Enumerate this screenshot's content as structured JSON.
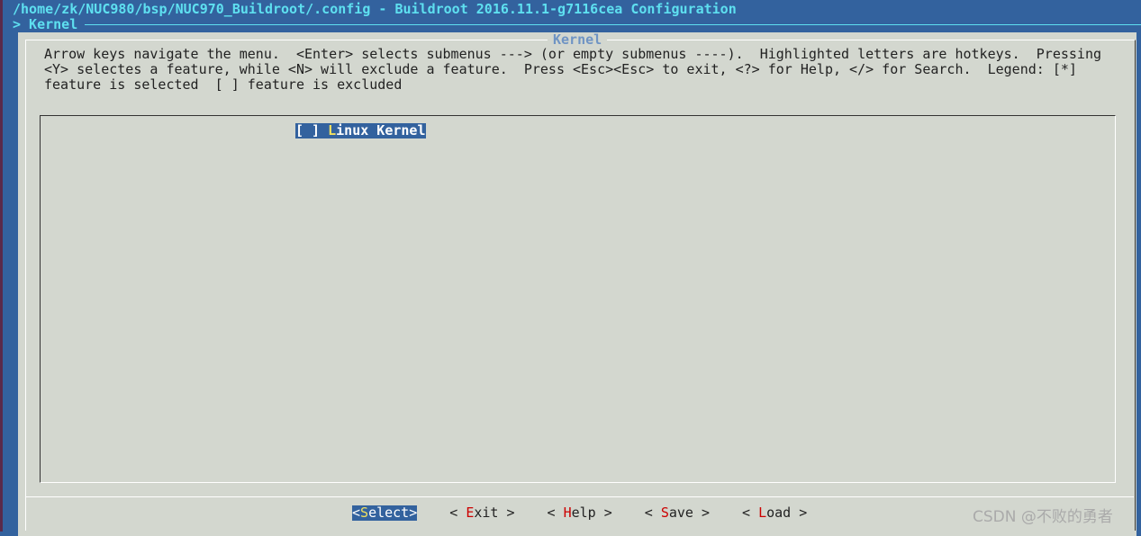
{
  "window": {
    "title": "/home/zk/NUC980/bsp/NUC970_Buildroot/.config - Buildroot 2016.11.1-g7116cea Configuration",
    "breadcrumb": "> Kernel"
  },
  "dialog": {
    "title": "Kernel",
    "help_lines": [
      "Arrow keys navigate the menu.  <Enter> selects submenus ---> (or empty submenus ----).  Highlighted letters are hotkeys.  Pressing",
      "<Y> selectes a feature, while <N> will exclude a feature.  Press <Esc><Esc> to exit, <?> for Help, </> for Search.  Legend: [*]",
      "feature is selected  [ ] feature is excluded"
    ],
    "items": [
      {
        "checkbox": "[ ]",
        "hotkey": "L",
        "rest": "inux Kernel",
        "checked": false,
        "highlighted": true
      }
    ]
  },
  "buttons": [
    {
      "pre": "<",
      "hotkey": "S",
      "rest": "elect",
      "post": ">",
      "selected": true
    },
    {
      "pre": "< ",
      "hotkey": "E",
      "rest": "xit",
      "post": " >",
      "selected": false
    },
    {
      "pre": "< ",
      "hotkey": "H",
      "rest": "elp",
      "post": " >",
      "selected": false
    },
    {
      "pre": "< ",
      "hotkey": "S",
      "rest": "ave",
      "post": " >",
      "selected": false
    },
    {
      "pre": "< ",
      "hotkey": "L",
      "rest": "oad",
      "post": " >",
      "selected": false
    }
  ],
  "watermark": "CSDN @不败的勇者",
  "colors": {
    "background": "#33629e",
    "dialog": "#d3d7cf",
    "title": "#5ee0f0",
    "hotkey": "#cc0000"
  }
}
